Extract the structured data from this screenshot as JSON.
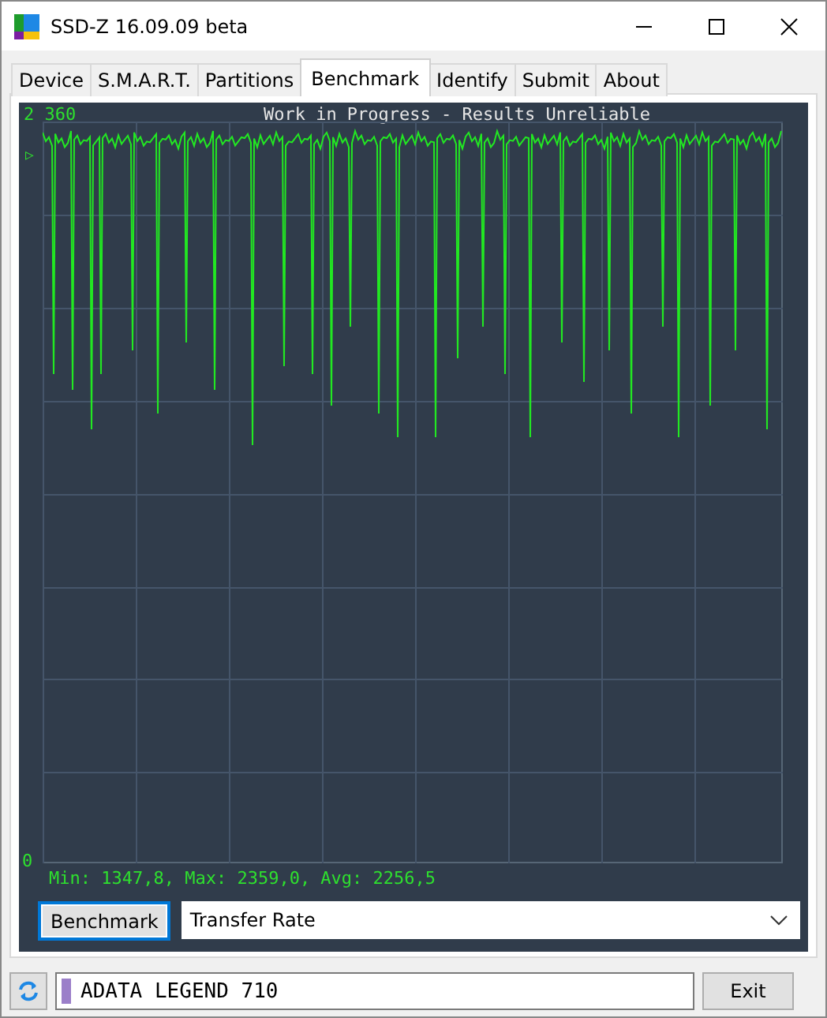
{
  "window": {
    "title": "SSD-Z 16.09.09 beta"
  },
  "tabs": [
    {
      "label": "Device",
      "selected": false
    },
    {
      "label": "S.M.A.R.T.",
      "selected": false
    },
    {
      "label": "Partitions",
      "selected": false
    },
    {
      "label": "Benchmark",
      "selected": true
    },
    {
      "label": "Identify",
      "selected": false
    },
    {
      "label": "Submit",
      "selected": false
    },
    {
      "label": "About",
      "selected": false
    }
  ],
  "chart": {
    "title": "Work in Progress - Results Unreliable",
    "y_max_label": "2 360",
    "y_min_label": "0",
    "marker": "▷",
    "stats": "Min: 1347,8, Max: 2359,0, Avg: 2256,5"
  },
  "controls": {
    "button": "Benchmark",
    "mode": "Transfer Rate"
  },
  "status_bar": {
    "drive": "ADATA LEGEND 710",
    "exit_button": "Exit"
  }
}
